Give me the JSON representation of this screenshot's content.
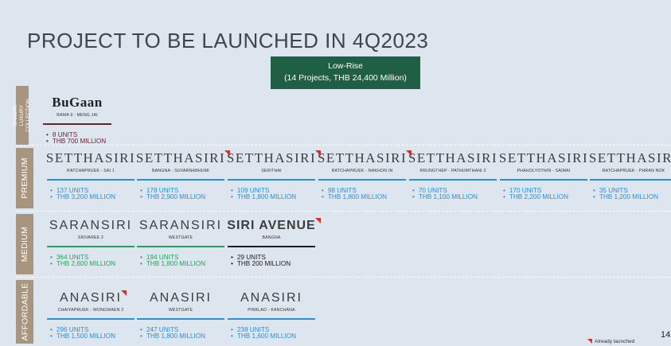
{
  "title": "PROJECT TO BE LAUNCHED IN 4Q2023",
  "lowrise": {
    "line1": "Low-Rise",
    "line2": "(14 Projects, THB 24,400 Million)",
    "color": "#1f5f43"
  },
  "tiers": {
    "luxury": "SANSIRI LUXURY COLLECTION",
    "premium": "PREMIUM",
    "medium": "MEDIUM",
    "affordable": "AFFORDABLE"
  },
  "luxury": [
    {
      "brand": "BuGaan",
      "location": "RAMA 9 - MENG JAI",
      "units": "8 UNITS",
      "value": "THB 700 MILLION",
      "launched": false
    }
  ],
  "premium": [
    {
      "brand": "SETTHASIRI",
      "location": "RATCHAPRUEK - SAI 1",
      "units": "137 UNITS",
      "value": "THB 3,200 MILLION",
      "launched": false
    },
    {
      "brand": "SETTHASIRI",
      "location": "BANGNA - SUVARNABHUMI",
      "units": "178 UNITS",
      "value": "THB 2,900 MILLION",
      "launched": true
    },
    {
      "brand": "SETTHASIRI",
      "location": "SERITHAI",
      "units": "109 UNITS",
      "value": "THB 1,800 MILLION",
      "launched": true
    },
    {
      "brand": "SETTHASIRI",
      "location": "RATCHAPRUEK - NAKHON IN",
      "units": "98 UNITS",
      "value": "THB 1,800 MILLION",
      "launched": true
    },
    {
      "brand": "SETTHASIRI",
      "location": "KRUNGTHEP - PATHUMTHANI 2",
      "units": "70 UNITS",
      "value": "THB 1,100 MILLION",
      "launched": false
    },
    {
      "brand": "SETTHASIRI",
      "location": "PHAHOLYOTHIN - SAIMAI",
      "units": "170 UNITS",
      "value": "THB 2,200 MILLION",
      "launched": false
    },
    {
      "brand": "SETTHASIRI",
      "location": "RATCHAPRUEK - PHRAN NOK",
      "units": "35 UNITS",
      "value": "THB 1,200 MILLION",
      "launched": false
    }
  ],
  "medium": [
    {
      "brand": "SARANSIRI",
      "location": "SRIVAREE 2",
      "units": "364 UNITS",
      "value": "THB 2,600 MILLION",
      "launched": false
    },
    {
      "brand": "SARANSIRI",
      "location": "WESTGATE",
      "units": "194 UNITS",
      "value": "THB 1,800 MILLION",
      "launched": false
    },
    {
      "brand": "SIRI AVENUE",
      "location": "BANGNA",
      "units": "29 UNITS",
      "value": "THB 200 MILLION",
      "launched": true
    }
  ],
  "affordable": [
    {
      "brand": "ANASIRI",
      "location": "CHAIYAPRUEK - WONGWAEN 2",
      "units": "296 UNITS",
      "value": "THB 1,500 MILLION",
      "launched": true
    },
    {
      "brand": "ANASIRI",
      "location": "WESTGATE",
      "units": "247 UNITS",
      "value": "THB 1,800 MILLION",
      "launched": false
    },
    {
      "brand": "ANASIRI",
      "location": "PINKLAO - KANCHANA",
      "units": "238 UNITS",
      "value": "THB 1,600 MILLION",
      "launched": false
    }
  ],
  "legend": "Already launched",
  "page_number": "14",
  "colors": {
    "luxury": "#6a1f2f",
    "premium": "#2a8fd6",
    "medium_saransiri": "#25a25a",
    "siri_avenue": "#1c1c1c",
    "affordable": "#2a8fd6",
    "launched_flag": "#e32b2b",
    "tier_label": "#a79580"
  }
}
